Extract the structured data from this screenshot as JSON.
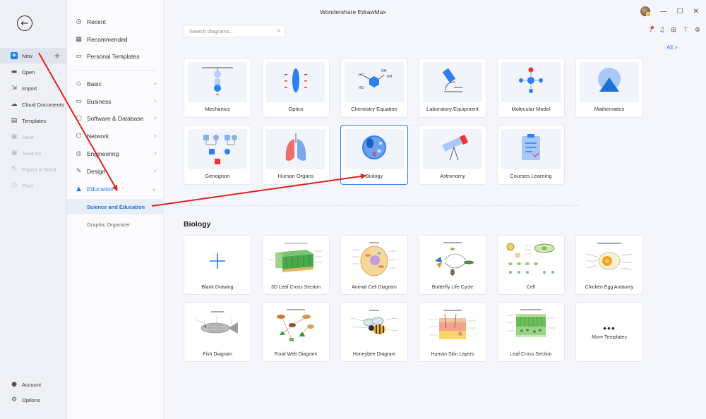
{
  "window": {
    "title": "Wondershare EdrawMax"
  },
  "sidebar_left": {
    "items": [
      {
        "label": "New",
        "icon": "plus-square-icon"
      },
      {
        "label": "Open",
        "icon": "folder-icon"
      },
      {
        "label": "Import",
        "icon": "import-icon"
      },
      {
        "label": "Cloud Documents",
        "icon": "cloud-icon"
      },
      {
        "label": "Templates",
        "icon": "templates-icon"
      },
      {
        "label": "Save",
        "icon": "save-icon"
      },
      {
        "label": "Save As",
        "icon": "save-as-icon"
      },
      {
        "label": "Export & Send",
        "icon": "export-icon"
      },
      {
        "label": "Print",
        "icon": "print-icon"
      }
    ],
    "bottom": [
      {
        "label": "Account",
        "icon": "account-icon"
      },
      {
        "label": "Options",
        "icon": "gear-icon"
      }
    ]
  },
  "sidebar_categories": {
    "top": [
      {
        "label": "Recent"
      },
      {
        "label": "Recommended"
      },
      {
        "label": "Personal Templates"
      }
    ],
    "groups": [
      {
        "label": "Basic"
      },
      {
        "label": "Business"
      },
      {
        "label": "Software & Database"
      },
      {
        "label": "Network"
      },
      {
        "label": "Engineering"
      },
      {
        "label": "Design"
      },
      {
        "label": "Education"
      }
    ],
    "subitems": [
      {
        "label": "Science and Education"
      },
      {
        "label": "Graphic Organizer"
      }
    ]
  },
  "search": {
    "placeholder": "Search diagrams..."
  },
  "all_link": "All  >",
  "categories": [
    {
      "label": "Mechanics"
    },
    {
      "label": "Optics"
    },
    {
      "label": "Chemistry Equation"
    },
    {
      "label": "Laboratory Equipment"
    },
    {
      "label": "Molecular Model"
    },
    {
      "label": "Mathematics"
    },
    {
      "label": "Genogram"
    },
    {
      "label": "Human Organs"
    },
    {
      "label": "Biology"
    },
    {
      "label": "Astronomy"
    },
    {
      "label": "Courses Learning"
    }
  ],
  "section_title": "Biology",
  "templates": [
    {
      "label": "Blank Drawing"
    },
    {
      "label": "3D Leaf Cross Section"
    },
    {
      "label": "Animal Cell Diagram"
    },
    {
      "label": "Butterfly Life Cycle"
    },
    {
      "label": "Cell"
    },
    {
      "label": "Chicken Egg Anatomy"
    },
    {
      "label": "Fish Diagram"
    },
    {
      "label": "Food Web Diagram"
    },
    {
      "label": "Honeybee Diagram"
    },
    {
      "label": "Human Skin Layers"
    },
    {
      "label": "Leaf Cross Section"
    }
  ],
  "more_templates": {
    "dots": "•••",
    "label": "More Templates"
  },
  "colors": {
    "accent": "#1a7ef0",
    "arrow": "#e02020"
  }
}
